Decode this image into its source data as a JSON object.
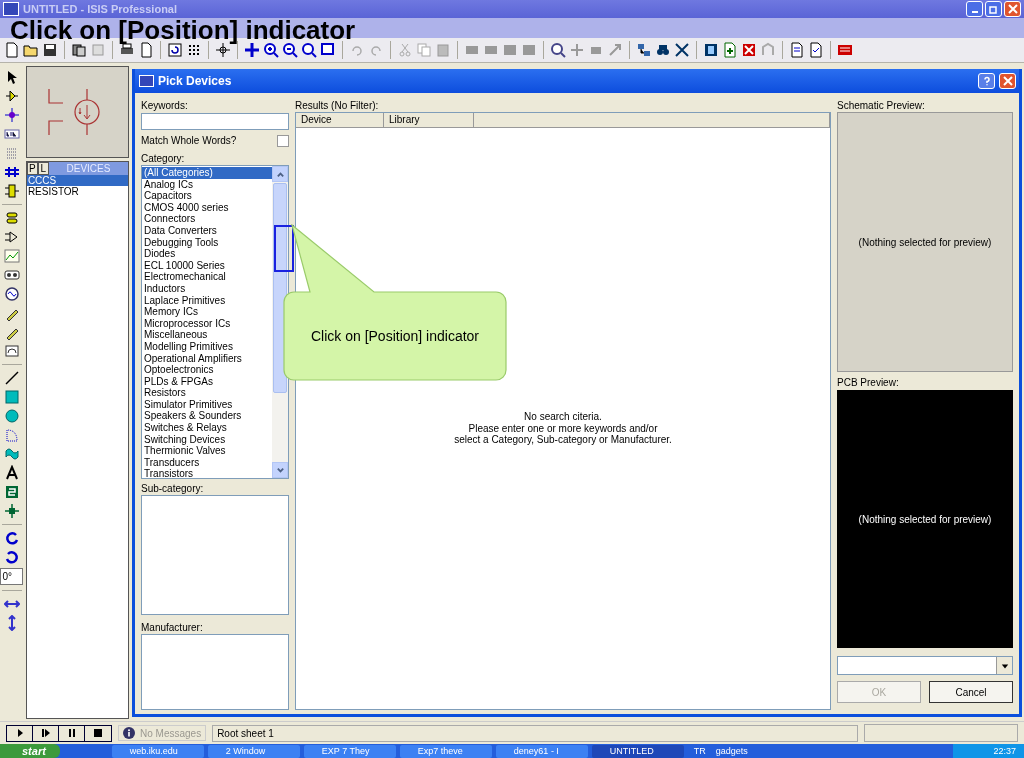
{
  "window": {
    "title": "UNTITLED - ISIS Professional"
  },
  "slide_title": "Click on [Position] indicator",
  "rotation_field": {
    "value": "0°"
  },
  "device_panel": {
    "tabs": [
      {
        "label": "P",
        "selected": false
      },
      {
        "label": "L",
        "selected": false
      }
    ],
    "header": "DEVICES",
    "items": [
      {
        "label": "CCCS",
        "selected": true
      },
      {
        "label": "RESISTOR",
        "selected": false
      }
    ]
  },
  "dialog": {
    "title": "Pick Devices",
    "keywords": {
      "label": "Keywords:"
    },
    "match_whole_words": {
      "label": "Match Whole Words?",
      "checked": false
    },
    "category": {
      "label": "Category:",
      "items": [
        {
          "label": "(All Categories)",
          "selected": true
        },
        {
          "label": "Analog ICs",
          "selected": false
        },
        {
          "label": "Capacitors",
          "selected": false
        },
        {
          "label": "CMOS 4000 series",
          "selected": false
        },
        {
          "label": "Connectors",
          "selected": false
        },
        {
          "label": "Data Converters",
          "selected": false
        },
        {
          "label": "Debugging Tools",
          "selected": false
        },
        {
          "label": "Diodes",
          "selected": false
        },
        {
          "label": "ECL 10000 Series",
          "selected": false
        },
        {
          "label": "Electromechanical",
          "selected": false
        },
        {
          "label": "Inductors",
          "selected": false
        },
        {
          "label": "Laplace Primitives",
          "selected": false
        },
        {
          "label": "Memory ICs",
          "selected": false
        },
        {
          "label": "Microprocessor ICs",
          "selected": false
        },
        {
          "label": "Miscellaneous",
          "selected": false
        },
        {
          "label": "Modelling Primitives",
          "selected": false
        },
        {
          "label": "Operational Amplifiers",
          "selected": false
        },
        {
          "label": "Optoelectronics",
          "selected": false
        },
        {
          "label": "PLDs & FPGAs",
          "selected": false
        },
        {
          "label": "Resistors",
          "selected": false
        },
        {
          "label": "Simulator Primitives",
          "selected": false
        },
        {
          "label": "Speakers & Sounders",
          "selected": false
        },
        {
          "label": "Switches & Relays",
          "selected": false
        },
        {
          "label": "Switching Devices",
          "selected": false
        },
        {
          "label": "Thermionic Valves",
          "selected": false
        },
        {
          "label": "Transducers",
          "selected": false
        },
        {
          "label": "Transistors",
          "selected": false
        }
      ]
    },
    "subcategory": {
      "label": "Sub-category:"
    },
    "manufacturer": {
      "label": "Manufacturer:"
    },
    "results": {
      "label": "Results (No Filter):",
      "columns": [
        "Device",
        "Library"
      ],
      "message": [
        "No search citeria.",
        "Please enter one or more keywords and/or",
        "select a Category, Sub-category or Manufacturer."
      ]
    },
    "schematic_preview": {
      "label": "Schematic Preview:",
      "message": "(Nothing selected for preview)"
    },
    "pcb_preview": {
      "label": "PCB Preview:",
      "message": "(Nothing selected for preview)"
    },
    "buttons": [
      {
        "label": "OK",
        "disabled": true
      },
      {
        "label": "Cancel",
        "disabled": false
      }
    ]
  },
  "callout": {
    "text": "Click on [Position] indicator"
  },
  "status_bar": {
    "messages": "No Messages",
    "sheet": "Root sheet 1"
  },
  "taskbar": {
    "start": "start",
    "items": [
      {
        "label": "web.iku.edu",
        "selected": false
      },
      {
        "label": "2 Window",
        "selected": false
      },
      {
        "label": "EXP 7 They",
        "selected": false
      },
      {
        "label": "Exp7 theve",
        "selected": false
      },
      {
        "label": "deney61 - I",
        "selected": false
      },
      {
        "label": "UNTITLED",
        "selected": true
      }
    ],
    "language": "TR",
    "gadgets": "gadgets",
    "clock": "22:37"
  }
}
